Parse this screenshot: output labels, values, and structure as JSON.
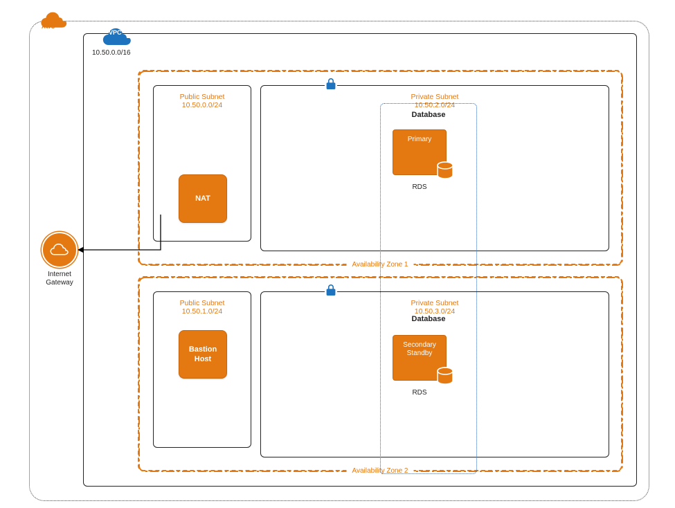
{
  "provider": {
    "label": "AWS"
  },
  "vpc": {
    "label": "VPC",
    "cidr": "10.50.0.0/16"
  },
  "az1": {
    "label": "Availability Zone 1",
    "public_subnet": {
      "title": "Public Subnet",
      "cidr": "10.50.0.0/24",
      "node_label": "NAT"
    },
    "private_subnet": {
      "title": "Private Subnet",
      "cidr": "10.50.2.0/24"
    }
  },
  "az2": {
    "label": "Availability Zone 2",
    "public_subnet": {
      "title": "Public Subnet",
      "cidr": "10.50.1.0/24",
      "node_label": "Bastion Host"
    },
    "private_subnet": {
      "title": "Private Subnet",
      "cidr": "10.50.3.0/24"
    }
  },
  "database": {
    "group_label": "Database",
    "primary": {
      "label": "Primary",
      "service": "RDS"
    },
    "secondary": {
      "label": "Secondary Standby",
      "service": "RDS"
    }
  },
  "igw": {
    "label": "Internet Gateway"
  }
}
